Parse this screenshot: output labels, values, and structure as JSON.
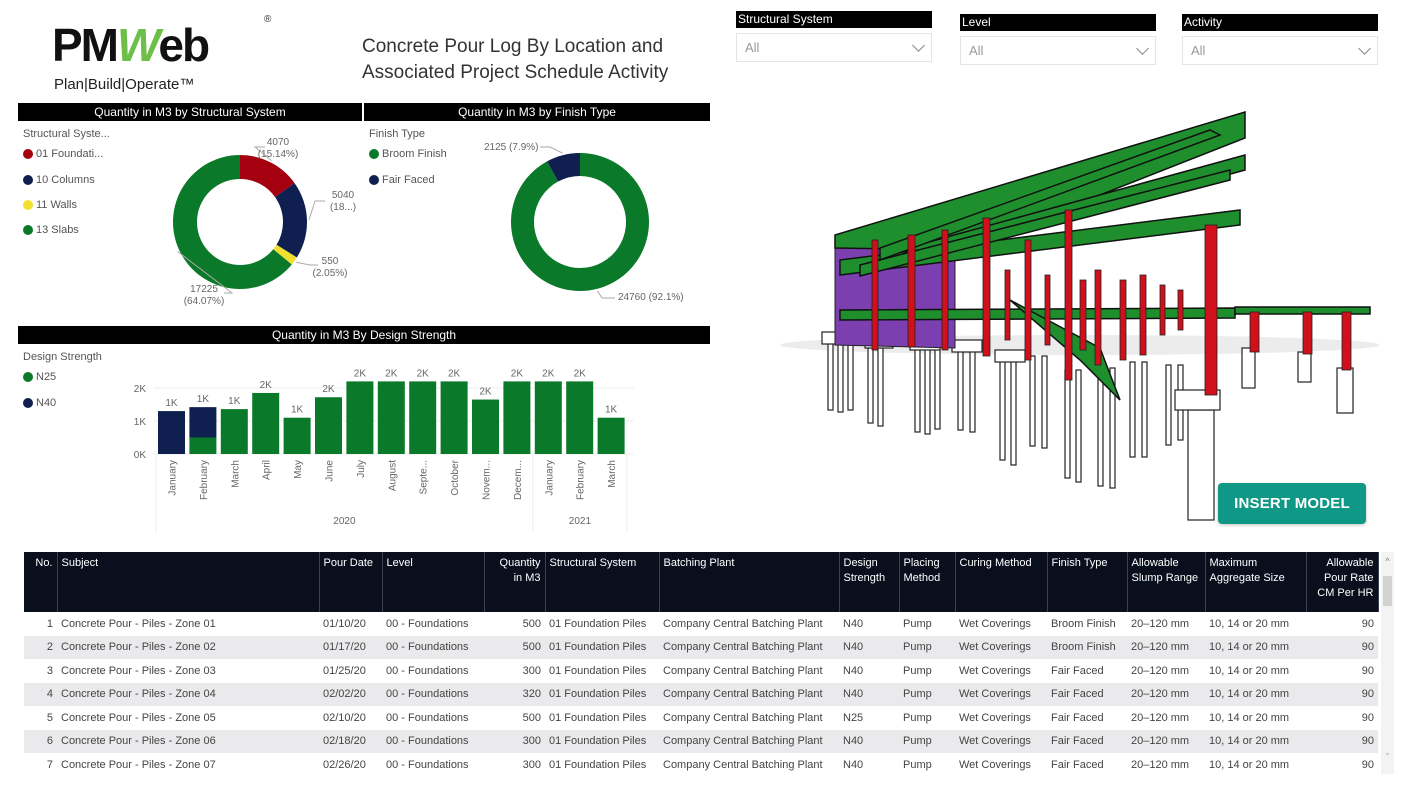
{
  "logo": {
    "brand_left": "PM",
    "brand_w": "W",
    "brand_right": "eb",
    "registered": "®",
    "tagline": "Plan|Build|Operate™"
  },
  "report_title_line1": "Concrete Pour Log By Location and",
  "report_title_line2": "Associated Project Schedule Activity",
  "slicers": [
    {
      "label": "Structural System",
      "value": "All"
    },
    {
      "label": "Level",
      "value": "All"
    },
    {
      "label": "Activity",
      "value": "All"
    }
  ],
  "insert_model_label": "INSERT MODEL",
  "colors": {
    "green": "#0a7a2a",
    "navy": "#0f1f4f",
    "red": "#a5000f",
    "yellow": "#f2df2f",
    "teal_button": "#0f9886",
    "header_black": "#000000"
  },
  "chart_data": [
    {
      "type": "pie",
      "title": "Quantity in M3 by Structural System",
      "legend_title": "Structural Syste...",
      "legend_position": "left",
      "donut": true,
      "slices": [
        {
          "label": "01 Foundati...",
          "full_label": "01 Foundation Piles",
          "value": 4070,
          "pct_label": "(15.14%)",
          "color": "#a5000f"
        },
        {
          "label": "10 Columns",
          "value": 5040,
          "pct_label": "(18...)",
          "color": "#0f1f4f"
        },
        {
          "label": "11 Walls",
          "value": 550,
          "pct_label": "(2.05%)",
          "color": "#f2df2f"
        },
        {
          "label": "13 Slabs",
          "value": 17225,
          "pct_label": "(64.07%)",
          "color": "#0a7a2a"
        }
      ]
    },
    {
      "type": "pie",
      "title": "Quantity in M3 by Finish Type",
      "legend_title": "Finish Type",
      "legend_position": "left",
      "donut": true,
      "slices": [
        {
          "label": "Broom Finish",
          "value": 24760,
          "pct_label": "(92.1%)",
          "color": "#0a7a2a"
        },
        {
          "label": "Fair Faced",
          "value": 2125,
          "pct_label": "(7.9%)",
          "color": "#0f1f4f"
        }
      ]
    },
    {
      "type": "bar",
      "stacked": true,
      "title": "Quantity in M3 By Design Strength",
      "legend_title": "Design Strength",
      "legend_position": "left",
      "xlabel": "",
      "ylabel": "",
      "ylim": [
        0,
        2000
      ],
      "yticks": [
        "0K",
        "1K",
        "2K"
      ],
      "grid": true,
      "categories": [
        "January",
        "February",
        "March",
        "April",
        "May",
        "June",
        "July",
        "August",
        "Septe...",
        "October",
        "Novem...",
        "Decem...",
        "January",
        "February",
        "March"
      ],
      "year_groups": [
        {
          "label": "2020",
          "count": 12
        },
        {
          "label": "2021",
          "count": 3
        }
      ],
      "series": [
        {
          "name": "N25",
          "color": "#0a7a2a",
          "values": [
            0,
            500,
            1360,
            1850,
            1100,
            1720,
            2200,
            2200,
            2200,
            2200,
            1650,
            2200,
            2200,
            2200,
            1100
          ]
        },
        {
          "name": "N40",
          "color": "#0f1f4f",
          "values": [
            1300,
            920,
            0,
            0,
            0,
            0,
            0,
            0,
            0,
            0,
            0,
            0,
            0,
            0,
            0
          ]
        }
      ],
      "data_labels": [
        "1K",
        "1K",
        "1K",
        "2K",
        "1K",
        "2K",
        "2K",
        "2K",
        "2K",
        "2K",
        "2K",
        "2K",
        "2K",
        "2K",
        "1K"
      ]
    }
  ],
  "table": {
    "columns": [
      {
        "label": "No.",
        "align": "right"
      },
      {
        "label": "Subject"
      },
      {
        "label": "Pour Date"
      },
      {
        "label": "Level"
      },
      {
        "label": "Quantity in M3",
        "align": "right"
      },
      {
        "label": "Structural System"
      },
      {
        "label": "Batching Plant"
      },
      {
        "label": "Design Strength"
      },
      {
        "label": "Placing Method"
      },
      {
        "label": "Curing Method"
      },
      {
        "label": "Finish Type"
      },
      {
        "label": "Allowable Slump Range"
      },
      {
        "label": "Maximum Aggregate Size"
      },
      {
        "label": "Allowable Pour Rate CM Per HR",
        "align": "right"
      }
    ],
    "rows": [
      [
        "1",
        "Concrete Pour - Piles - Zone 01",
        "01/10/20",
        "00 - Foundations",
        "500",
        "01 Foundation Piles",
        "Company Central Batching Plant",
        "N40",
        "Pump",
        "Wet Coverings",
        "Broom Finish",
        "20–120 mm",
        "10, 14 or 20 mm",
        "90"
      ],
      [
        "2",
        "Concrete Pour - Piles - Zone 02",
        "01/17/20",
        "00 - Foundations",
        "500",
        "01 Foundation Piles",
        "Company Central Batching Plant",
        "N40",
        "Pump",
        "Wet Coverings",
        "Broom Finish",
        "20–120 mm",
        "10, 14 or 20 mm",
        "90"
      ],
      [
        "3",
        "Concrete Pour - Piles - Zone 03",
        "01/25/20",
        "00 - Foundations",
        "300",
        "01 Foundation Piles",
        "Company Central Batching Plant",
        "N40",
        "Pump",
        "Wet Coverings",
        "Fair Faced",
        "20–120 mm",
        "10, 14 or 20 mm",
        "90"
      ],
      [
        "4",
        "Concrete Pour - Piles - Zone 04",
        "02/02/20",
        "00 - Foundations",
        "320",
        "01 Foundation Piles",
        "Company Central Batching Plant",
        "N40",
        "Pump",
        "Wet Coverings",
        "Fair Faced",
        "20–120 mm",
        "10, 14 or 20 mm",
        "90"
      ],
      [
        "5",
        "Concrete Pour - Piles - Zone 05",
        "02/10/20",
        "00 - Foundations",
        "500",
        "01 Foundation Piles",
        "Company Central Batching Plant",
        "N25",
        "Pump",
        "Wet Coverings",
        "Fair Faced",
        "20–120 mm",
        "10, 14 or 20 mm",
        "90"
      ],
      [
        "6",
        "Concrete Pour - Piles - Zone 06",
        "02/18/20",
        "00 - Foundations",
        "300",
        "01 Foundation Piles",
        "Company Central Batching Plant",
        "N40",
        "Pump",
        "Wet Coverings",
        "Fair Faced",
        "20–120 mm",
        "10, 14 or 20 mm",
        "90"
      ],
      [
        "7",
        "Concrete Pour - Piles - Zone 07",
        "02/26/20",
        "00 - Foundations",
        "300",
        "01 Foundation Piles",
        "Company Central Batching Plant",
        "N40",
        "Pump",
        "Wet Coverings",
        "Fair Faced",
        "20–120 mm",
        "10, 14 or 20 mm",
        "90"
      ]
    ]
  }
}
